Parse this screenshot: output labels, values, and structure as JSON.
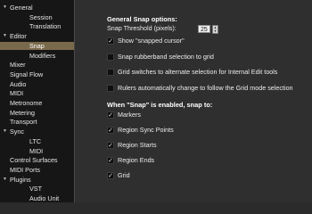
{
  "sidebar": {
    "items": [
      {
        "label": "General",
        "level": 0,
        "expanded": true
      },
      {
        "label": "Session",
        "level": 1
      },
      {
        "label": "Translation",
        "level": 1
      },
      {
        "label": "Editor",
        "level": 0,
        "expanded": true
      },
      {
        "label": "Snap",
        "level": 1,
        "selected": true
      },
      {
        "label": "Modifiers",
        "level": 1
      },
      {
        "label": "Mixer",
        "level": 0
      },
      {
        "label": "Signal Flow",
        "level": 0
      },
      {
        "label": "Audio",
        "level": 0
      },
      {
        "label": "MIDI",
        "level": 0
      },
      {
        "label": "Metronome",
        "level": 0
      },
      {
        "label": "Metering",
        "level": 0
      },
      {
        "label": "Transport",
        "level": 0
      },
      {
        "label": "Sync",
        "level": 0,
        "expanded": true
      },
      {
        "label": "LTC",
        "level": 1
      },
      {
        "label": "MIDI",
        "level": 1
      },
      {
        "label": "Control Surfaces",
        "level": 0
      },
      {
        "label": "MIDI Ports",
        "level": 0
      },
      {
        "label": "Plugins",
        "level": 0,
        "expanded": true
      },
      {
        "label": "VST",
        "level": 1
      },
      {
        "label": "Audio Unit",
        "level": 1
      }
    ]
  },
  "general_snap": {
    "title": "General Snap options:",
    "threshold_label": "Snap Threshold (pixels):",
    "threshold_value": "25",
    "options": [
      {
        "label": "Show \"snapped cursor\"",
        "checked": true
      },
      {
        "label": "Snap rubberband selection to grid",
        "checked": false
      },
      {
        "label": "Grid switches to alternate selection for Internal Edit tools",
        "checked": false
      },
      {
        "label": "Rulers automatically change to follow the Grid mode selection",
        "checked": false
      }
    ]
  },
  "snap_to": {
    "title": "When \"Snap\" is enabled, snap to:",
    "options": [
      {
        "label": "Markers",
        "checked": true
      },
      {
        "label": "Region Sync Points",
        "checked": true
      },
      {
        "label": "Region Starts",
        "checked": true
      },
      {
        "label": "Region Ends",
        "checked": true
      },
      {
        "label": "Grid",
        "checked": true
      }
    ]
  },
  "glyphs": {
    "expanded": "▼",
    "check": "✓"
  }
}
